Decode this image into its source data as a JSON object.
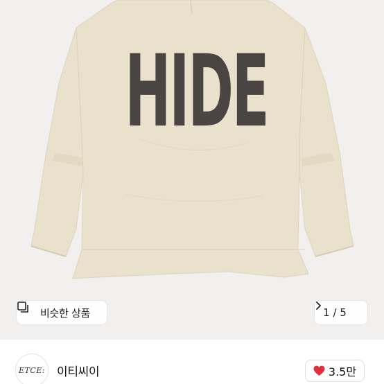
{
  "image": {
    "graphic_text": "HIDE",
    "colors": {
      "background": "#f1f0ee",
      "shirt": "#e9e0cc",
      "print": "#4a4443"
    }
  },
  "overlay": {
    "similar_button": {
      "label": "비슷한 상품",
      "icon": "similar-items-icon"
    },
    "pager": {
      "current": "1",
      "total": "5",
      "text": "1 / 5",
      "icon": "chevron-right-icon"
    }
  },
  "seller": {
    "avatar_text": "ETCE:",
    "name": "이티씨이"
  },
  "like": {
    "count": "3.5만",
    "icon": "heart-icon",
    "color": "#e0303e"
  }
}
